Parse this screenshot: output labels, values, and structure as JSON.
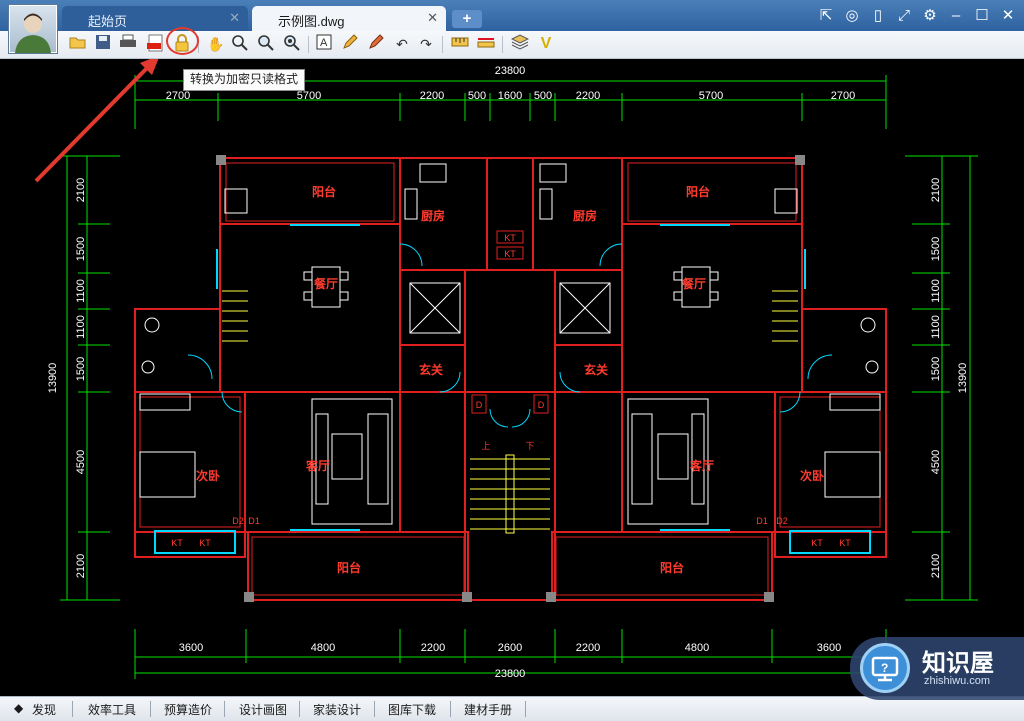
{
  "window": {
    "tabs": [
      {
        "label": "起始页"
      },
      {
        "label": "示例图.dwg"
      }
    ],
    "add_tab_label": "+",
    "right_icons": [
      "share-icon",
      "wechat-icon",
      "mobile-icon",
      "fullscreen-icon",
      "settings-icon",
      "minimize-icon",
      "maximize-icon",
      "close-icon"
    ]
  },
  "toolbar": {
    "tools": [
      "open-icon",
      "save-icon",
      "print-icon",
      "pdf-export-icon",
      "lock-encrypt-icon",
      "pan-icon",
      "zoom-extents-icon",
      "zoom-in-icon",
      "zoom-out-icon",
      "text-icon",
      "pencil-icon",
      "highlighter-icon",
      "undo-icon",
      "redo-icon",
      "measure-icon",
      "dimension-icon",
      "layers-icon",
      "check-icon"
    ],
    "tooltip": "转换为加密只读格式"
  },
  "drawing": {
    "dim_overall_top": "23800",
    "dim_overall_bottom": "23800",
    "dims_top": [
      "2700",
      "5700",
      "2200",
      "500",
      "1600",
      "500",
      "2200",
      "5700",
      "2700"
    ],
    "dims_bottom": [
      "3600",
      "4800",
      "2200",
      "2600",
      "2200",
      "4800",
      "3600"
    ],
    "dims_left": [
      "2100",
      "1500",
      "1100",
      "1100",
      "1500",
      "4500",
      "2100"
    ],
    "dims_right": [
      "2100",
      "1500",
      "1100",
      "1100",
      "1500",
      "4500",
      "2100"
    ],
    "dim_overall_left": "13900",
    "dim_overall_right": "13900",
    "rooms": {
      "balcony": "阳台",
      "kitchen": "厨房",
      "dining": "餐厅",
      "foyer": "玄关",
      "living": "客厅",
      "bedroom": "次卧"
    },
    "stair_up": "上",
    "stair_down": "下",
    "labels": {
      "d": "D",
      "d1": "D1",
      "d2": "D2",
      "cab": "KT"
    }
  },
  "status_tabs": [
    "发现",
    "效率工具",
    "预算造价",
    "设计画图",
    "家装设计",
    "图库下载",
    "建材手册"
  ],
  "watermark": {
    "name": "知识屋",
    "site": "zhishiwu.com"
  },
  "colors": {
    "wall": "#e02020",
    "dimension": "#00e000",
    "text_dim": "#ffffff",
    "room_label": "#ff3b2e",
    "window": "#00d8ff",
    "furniture": "#ffffff",
    "stair": "#ffff40"
  }
}
